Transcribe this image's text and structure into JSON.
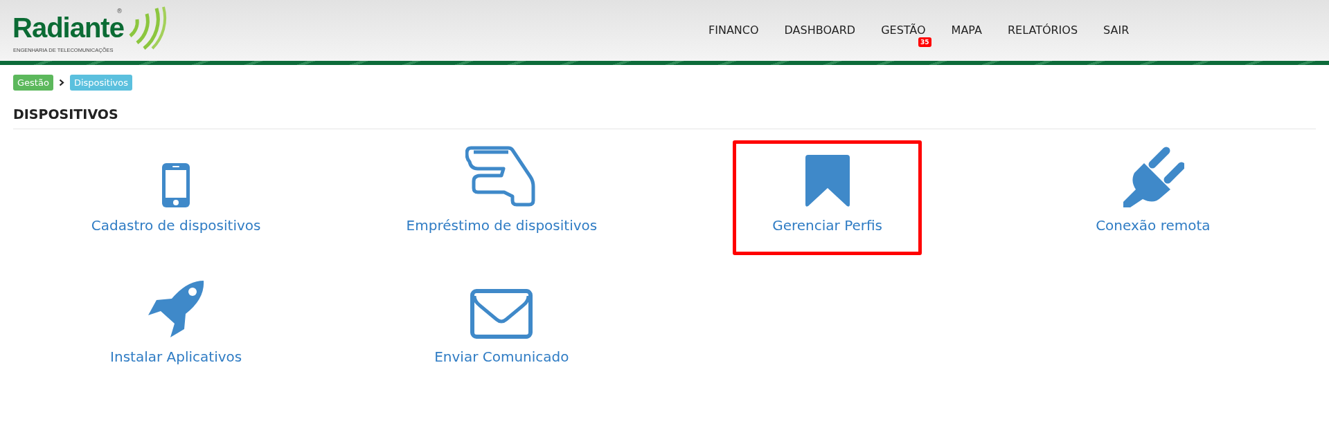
{
  "logo": {
    "name": "Radiante",
    "registered": "®",
    "tagline": "ENGENHARIA DE TELECOMUNICAÇÕES"
  },
  "nav": [
    {
      "label": "FINANCO"
    },
    {
      "label": "DASHBOARD"
    },
    {
      "label": "GESTÃO",
      "badge": "35"
    },
    {
      "label": "MAPA"
    },
    {
      "label": "RELATÓRIOS"
    },
    {
      "label": "SAIR"
    }
  ],
  "breadcrumb": [
    {
      "label": "Gestão",
      "color": "#5cb85c"
    },
    {
      "label": "Dispositivos",
      "color": "#5bc0de"
    }
  ],
  "page_title": "DISPOSITIVOS",
  "tiles": [
    {
      "kind": "phone",
      "label": "Cadastro de dispositivos",
      "highlighted": false
    },
    {
      "kind": "hand",
      "label": "Empréstimo de dispositivos",
      "highlighted": false
    },
    {
      "kind": "bookmark",
      "label": "Gerenciar Perfis",
      "highlighted": true
    },
    {
      "kind": "plug",
      "label": "Conexão remota",
      "highlighted": false
    },
    {
      "kind": "rocket",
      "label": "Instalar Aplicativos",
      "highlighted": false
    },
    {
      "kind": "envelope",
      "label": "Enviar Comunicado",
      "highlighted": false
    }
  ]
}
